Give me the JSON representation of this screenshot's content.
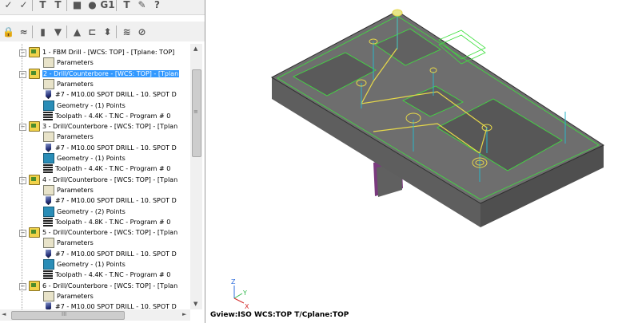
{
  "tree": {
    "items": [
      {
        "id": "op1",
        "label": "1 - FBM Drill - [WCS: TOP] - [Tplane: TOP]",
        "kind": "op",
        "selected": false
      },
      {
        "id": "op1p",
        "label": "Parameters",
        "kind": "params"
      },
      {
        "id": "op2",
        "label": "2 - Drill/Counterbore - [WCS: TOP] - [Tplan",
        "kind": "op",
        "selected": true
      },
      {
        "id": "op2p",
        "label": "Parameters",
        "kind": "params"
      },
      {
        "id": "op2t",
        "label": "#7 - M10.00 SPOT DRILL - 10. SPOT D",
        "kind": "tool"
      },
      {
        "id": "op2g",
        "label": "Geometry - (1) Points",
        "kind": "geom"
      },
      {
        "id": "op2tp",
        "label": "Toolpath - 4.4K - T.NC - Program # 0",
        "kind": "toolpath"
      },
      {
        "id": "op3",
        "label": "3 - Drill/Counterbore - [WCS: TOP] - [Tplan",
        "kind": "op",
        "selected": false
      },
      {
        "id": "op3p",
        "label": "Parameters",
        "kind": "params"
      },
      {
        "id": "op3t",
        "label": "#7 - M10.00 SPOT DRILL - 10. SPOT D",
        "kind": "tool"
      },
      {
        "id": "op3g",
        "label": "Geometry - (1) Points",
        "kind": "geom"
      },
      {
        "id": "op3tp",
        "label": "Toolpath - 4.4K - T.NC - Program # 0",
        "kind": "toolpath"
      },
      {
        "id": "op4",
        "label": "4 - Drill/Counterbore - [WCS: TOP] - [Tplan",
        "kind": "op",
        "selected": false
      },
      {
        "id": "op4p",
        "label": "Parameters",
        "kind": "params"
      },
      {
        "id": "op4t",
        "label": "#7 - M10.00 SPOT DRILL - 10. SPOT D",
        "kind": "tool"
      },
      {
        "id": "op4g",
        "label": "Geometry - (2) Points",
        "kind": "geom"
      },
      {
        "id": "op4tp",
        "label": "Toolpath - 4.8K - T.NC - Program # 0",
        "kind": "toolpath"
      },
      {
        "id": "op5",
        "label": "5 - Drill/Counterbore - [WCS: TOP] - [Tplan",
        "kind": "op",
        "selected": false
      },
      {
        "id": "op5p",
        "label": "Parameters",
        "kind": "params"
      },
      {
        "id": "op5t",
        "label": "#7 - M10.00 SPOT DRILL - 10. SPOT D",
        "kind": "tool"
      },
      {
        "id": "op5g",
        "label": "Geometry - (1) Points",
        "kind": "geom"
      },
      {
        "id": "op5tp",
        "label": "Toolpath - 4.4K - T.NC - Program # 0",
        "kind": "toolpath"
      },
      {
        "id": "op6",
        "label": "6 - Drill/Counterbore - [WCS: TOP] - [Tplan",
        "kind": "op",
        "selected": false
      },
      {
        "id": "op6p",
        "label": "Parameters",
        "kind": "params"
      },
      {
        "id": "op6t",
        "label": "#7 - M10.00 SPOT DRILL - 10. SPOT D",
        "kind": "tool"
      }
    ]
  },
  "toolbar": {
    "row1": [
      "select-all-icon",
      "regen-icon",
      "toggle-display-icon",
      "toggle-display-2-icon",
      "backplot-icon",
      "verify-icon",
      "gcode-icon",
      "post-icon",
      "highfeed-icon",
      "help-icon"
    ],
    "row1_glyphs": [
      "✓",
      "✓",
      "T",
      "T",
      "■",
      "●",
      "G1",
      "T",
      "✎",
      "?"
    ],
    "row2": [
      "lock-icon",
      "wave-icon",
      "delete-icon",
      "move-down-icon",
      "move-up-icon",
      "insert-icon",
      "expand-icon",
      "toggle-icon",
      "zoom-icon"
    ],
    "row2_glyphs": [
      "🔒",
      "≈",
      "▮",
      "▼",
      "▲",
      "⊏",
      "⬍",
      "≋",
      "⊘"
    ]
  },
  "viewport": {
    "axis_z": "Z",
    "axis_y": "Y",
    "axis_x": "X",
    "status": "Gview:ISO   WCS:TOP   T/Cplane:TOP",
    "colors": {
      "part_top": "#6e6e6e",
      "part_side": "#585858",
      "edges": "#3fe03f",
      "toolpath": "#e6d84a",
      "axis": "#29b6c8",
      "base": "#7a3a7e"
    }
  },
  "scrollbars": {
    "up": "▲",
    "down": "▼",
    "left": "◄",
    "right": "►",
    "grip": "III",
    "grip_v": "≡"
  }
}
